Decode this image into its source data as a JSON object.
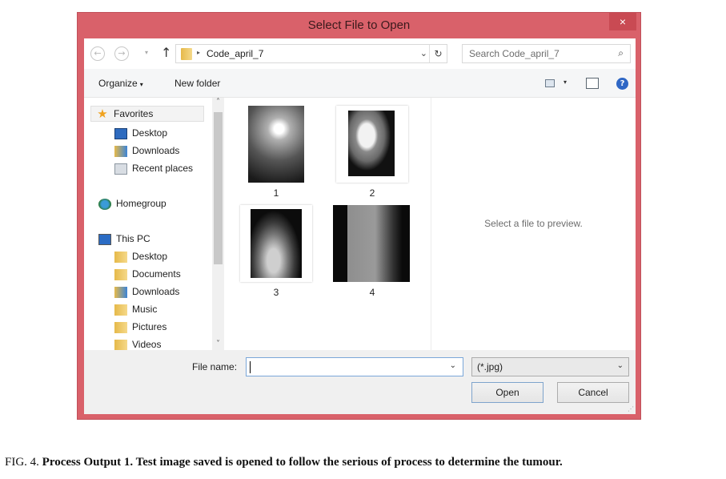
{
  "window": {
    "title": "Select File to Open",
    "close_label": "×"
  },
  "navigation": {
    "back_icon": "←",
    "forward_icon": "→",
    "recent_icon": "▾",
    "up_icon": "↑",
    "breadcrumb_arrow": "▸",
    "current_folder": "Code_april_7",
    "address_dropdown_icon": "⌄",
    "refresh_icon": "↻",
    "search_placeholder": "Search Code_april_7",
    "search_icon": "⌕"
  },
  "toolbar": {
    "organize_label": "Organize",
    "organize_caret": "▾",
    "new_folder_label": "New folder",
    "view_caret": "▾",
    "help_label": "?"
  },
  "sidebar": {
    "scroll_up": "˄",
    "scroll_down": "˅",
    "items": [
      {
        "label": "Favorites",
        "icon": "star-icon"
      },
      {
        "label": "Desktop",
        "icon": "desktop-icon"
      },
      {
        "label": "Downloads",
        "icon": "downloads-icon"
      },
      {
        "label": "Recent places",
        "icon": "recent-places-icon"
      },
      {
        "label": "Homegroup",
        "icon": "homegroup-icon"
      },
      {
        "label": "This PC",
        "icon": "computer-icon"
      },
      {
        "label": "Desktop",
        "icon": "desktop-folder-icon"
      },
      {
        "label": "Documents",
        "icon": "documents-folder-icon"
      },
      {
        "label": "Downloads",
        "icon": "downloads-folder-icon"
      },
      {
        "label": "Music",
        "icon": "music-folder-icon"
      },
      {
        "label": "Pictures",
        "icon": "pictures-folder-icon"
      },
      {
        "label": "Videos",
        "icon": "videos-folder-icon"
      }
    ]
  },
  "files": [
    {
      "name": "1"
    },
    {
      "name": "2"
    },
    {
      "name": "3"
    },
    {
      "name": "4"
    }
  ],
  "preview": {
    "message": "Select a file to preview."
  },
  "footer": {
    "file_name_label": "File name:",
    "file_name_value": "",
    "file_name_dropdown": "⌄",
    "file_type_value": "(*.jpg)",
    "file_type_dropdown": "⌄",
    "open_label": "Open",
    "cancel_label": "Cancel",
    "grip": "⋰"
  },
  "caption": {
    "prefix": "FIG. 4. ",
    "bold": "Process Output 1. Test image saved is opened to follow the serious of process to determine the tumour."
  }
}
